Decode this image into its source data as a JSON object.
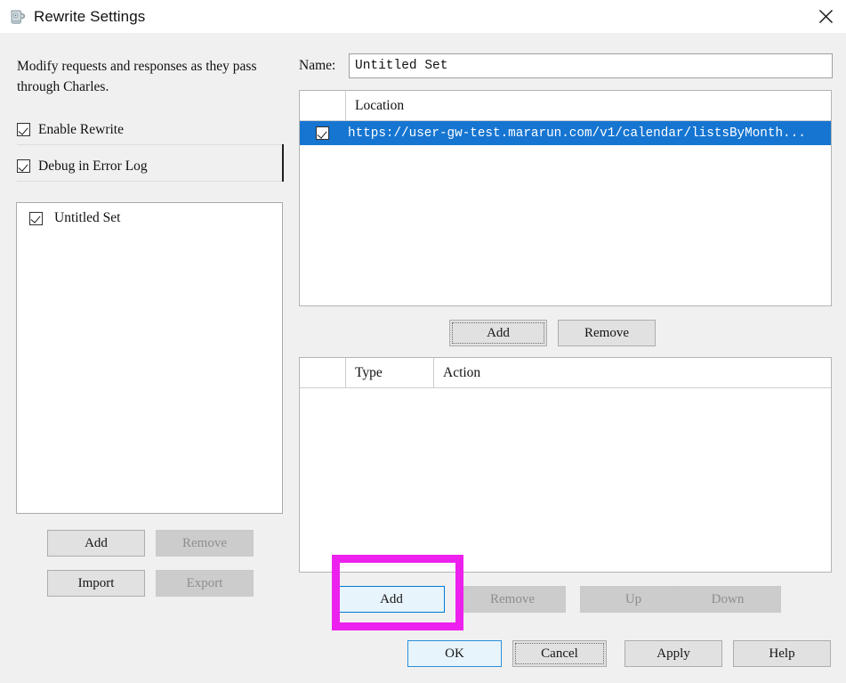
{
  "window": {
    "title": "Rewrite Settings",
    "icon": "charles-pitcher-icon",
    "close_icon": "close-icon"
  },
  "left": {
    "intro_text": "Modify requests and responses as they pass through Charles.",
    "options": [
      {
        "label": "Enable Rewrite",
        "checked": true
      },
      {
        "label": "Debug in Error Log",
        "checked": true
      }
    ],
    "sets": [
      {
        "label": "Untitled Set",
        "checked": true
      }
    ],
    "buttons": [
      {
        "label": "Add",
        "enabled": true
      },
      {
        "label": "Remove",
        "enabled": false
      },
      {
        "label": "Import",
        "enabled": true
      },
      {
        "label": "Export",
        "enabled": false
      }
    ]
  },
  "right": {
    "name_label": "Name:",
    "name_value": "Untitled Set",
    "locations": {
      "column_header": "Location",
      "rows": [
        {
          "checked": true,
          "location": "https://user-gw-test.mararun.com/v1/calendar/listsByMonth...",
          "selected": true
        }
      ],
      "buttons": [
        {
          "label": "Add",
          "enabled": true,
          "focused": true
        },
        {
          "label": "Remove",
          "enabled": true
        }
      ]
    },
    "rules": {
      "columns": [
        "Type",
        "Action"
      ],
      "rows": [],
      "buttons": [
        {
          "label": "Add",
          "enabled": true,
          "hovered": true
        },
        {
          "label": "Remove",
          "enabled": false
        },
        {
          "label": "Up",
          "enabled": false
        },
        {
          "label": "Down",
          "enabled": false
        }
      ]
    }
  },
  "dialog_buttons": [
    {
      "label": "OK",
      "default": true
    },
    {
      "label": "Cancel",
      "focused": true
    },
    {
      "label": "Apply"
    },
    {
      "label": "Help"
    }
  ],
  "annotation": {
    "type": "highlight-rectangle",
    "color": "#ed21ed",
    "target": "rules-add-button"
  }
}
